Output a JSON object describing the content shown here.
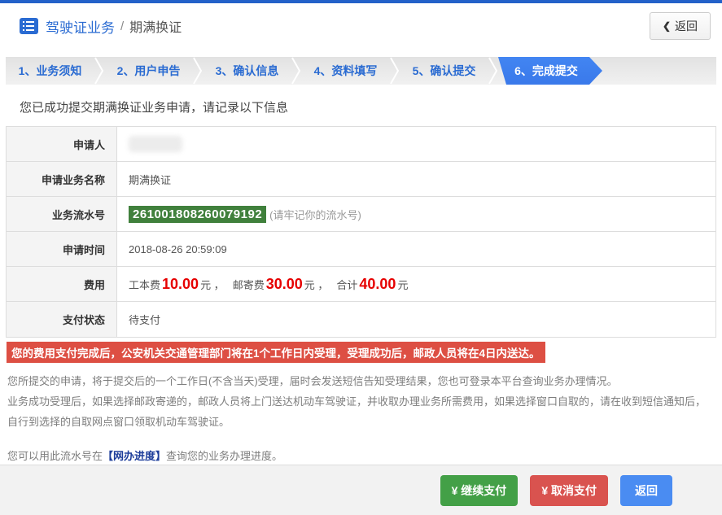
{
  "header": {
    "icon": "document-list-icon",
    "title_primary": "驾驶证业务",
    "title_separator": "/",
    "title_secondary": "期满换证",
    "back_button": {
      "chevron": "❮",
      "label": "返回"
    }
  },
  "steps": {
    "items": [
      {
        "label": "1、业务须知",
        "active": false
      },
      {
        "label": "2、用户申告",
        "active": false
      },
      {
        "label": "3、确认信息",
        "active": false
      },
      {
        "label": "4、资料填写",
        "active": false
      },
      {
        "label": "5、确认提交",
        "active": false
      },
      {
        "label": "6、完成提交",
        "active": true
      }
    ]
  },
  "main": {
    "success_message": "您已成功提交期满换证业务申请，请记录以下信息",
    "table": {
      "rows": [
        {
          "label": "申请人",
          "value": "",
          "redacted": true
        },
        {
          "label": "申请业务名称",
          "value": "期满换证"
        },
        {
          "label": "业务流水号",
          "serial": "261001808260079192",
          "hint": "(请牢记你的流水号)"
        },
        {
          "label": "申请时间",
          "value": "2018-08-26 20:59:09"
        },
        {
          "label": "费用",
          "fee": {
            "label1": "工本费",
            "amount1": "10.00",
            "unit1": "元 ，",
            "label2": "邮寄费",
            "amount2": "30.00",
            "unit2": "元 ，",
            "label3": "合计",
            "amount3": "40.00",
            "unit3": "元"
          }
        },
        {
          "label": "支付状态",
          "value": "待支付"
        }
      ]
    },
    "warning": "您的费用支付完成后，公安机关交通管理部门将在1个工作日内受理，受理成功后，邮政人员将在4日内送达。",
    "paragraphs": [
      "您所提交的申请，将于提交后的一个工作日(不含当天)受理，届时会发送短信告知受理结果，您也可登录本平台查询业务办理情况。",
      "业务成功受理后，如果选择邮政寄递的，邮政人员将上门送达机动车驾驶证，并收取办理业务所需费用，如果选择窗口自取的，请在收到短信通知后，",
      "自行到选择的自取网点窗口领取机动车驾驶证。"
    ],
    "progress_note": {
      "prefix": "您可以用此流水号在",
      "highlight": "【网办进度】",
      "suffix": "查询您的业务办理进度。"
    }
  },
  "footer": {
    "buttons": [
      {
        "label": "¥ 继续支付",
        "color": "#43a047"
      },
      {
        "label": "¥ 取消支付",
        "color": "#d9534f"
      },
      {
        "label": "返回",
        "color": "#4a8cf2"
      }
    ]
  },
  "colors": {
    "top_bar_blue": "#2361c9",
    "primary_blue": "#2a6bd2",
    "active_step_blue": "#3c7ef0",
    "serial_green": "#40803c",
    "warning_red": "#dd4f43",
    "fee_red": "#e60000",
    "progress_navy": "#1d3d9a"
  }
}
